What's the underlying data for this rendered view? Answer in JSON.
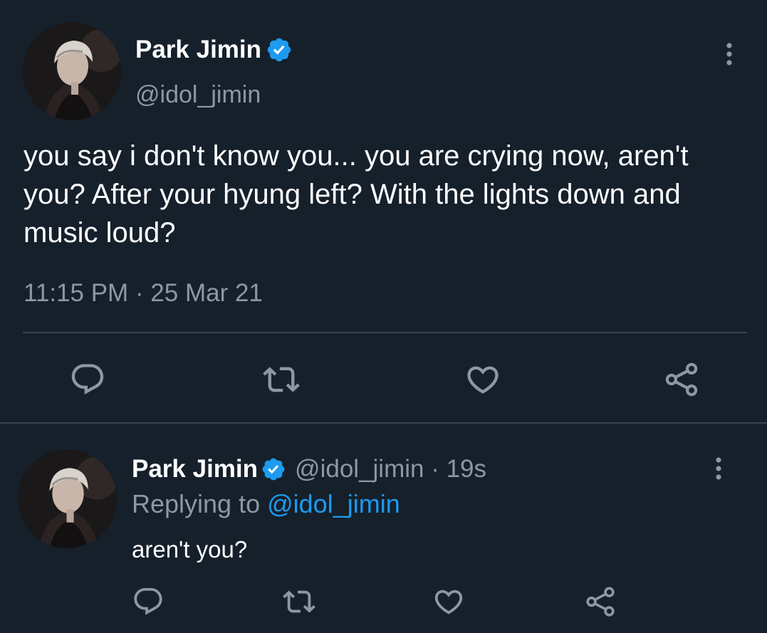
{
  "main_tweet": {
    "author_name": "Park Jimin",
    "handle": "@idol_jimin",
    "text": "you say i don't know you... you are crying now, aren't you? After your hyung left? With the lights down and music loud?",
    "timestamp": "11:15 PM · 25 Mar 21"
  },
  "reply_tweet": {
    "author_name": "Park Jimin",
    "meta": "@idol_jimin · 19s",
    "replying_prefix": "Replying to ",
    "replying_handle": "@idol_jimin",
    "text": "aren't you?"
  },
  "icons": {
    "verified": "verified-badge-icon",
    "more": "more-vertical-icon",
    "reply": "reply-icon",
    "retweet": "retweet-icon",
    "like": "heart-icon",
    "share": "share-icon"
  },
  "colors": {
    "background": "#15202b",
    "text_primary": "#ffffff",
    "text_secondary": "#8b98a5",
    "accent": "#1d9bf0",
    "divider": "#38444d"
  }
}
